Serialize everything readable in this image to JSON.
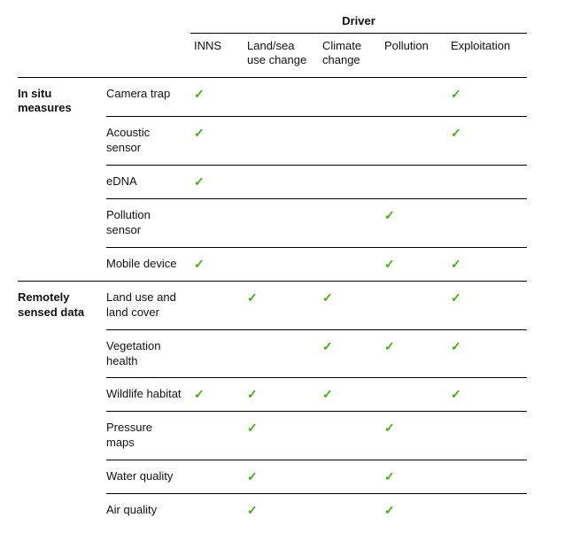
{
  "header": {
    "super": "Driver"
  },
  "columns": [
    "INNS",
    "Land/sea use change",
    "Climate change",
    "Pollution",
    "Exploitation"
  ],
  "groups": [
    {
      "name": "In situ measures",
      "rows": [
        {
          "label": "Camera trap",
          "marks": [
            true,
            false,
            false,
            false,
            true
          ]
        },
        {
          "label": "Acoustic sensor",
          "marks": [
            true,
            false,
            false,
            false,
            true
          ]
        },
        {
          "label": "eDNA",
          "marks": [
            true,
            false,
            false,
            false,
            false
          ]
        },
        {
          "label": "Pollution sensor",
          "marks": [
            false,
            false,
            false,
            true,
            false
          ]
        },
        {
          "label": "Mobile device",
          "marks": [
            true,
            false,
            false,
            true,
            true
          ]
        }
      ]
    },
    {
      "name": "Remotely sensed data",
      "rows": [
        {
          "label": "Land use and land cover",
          "marks": [
            false,
            true,
            true,
            false,
            true
          ]
        },
        {
          "label": "Vegetation health",
          "marks": [
            false,
            false,
            true,
            true,
            true
          ]
        },
        {
          "label": "Wildlife habitat",
          "marks": [
            true,
            true,
            true,
            false,
            true
          ]
        },
        {
          "label": "Pressure maps",
          "marks": [
            false,
            true,
            false,
            true,
            false
          ]
        },
        {
          "label": "Water quality",
          "marks": [
            false,
            true,
            false,
            true,
            false
          ]
        },
        {
          "label": "Air quality",
          "marks": [
            false,
            true,
            false,
            true,
            false
          ]
        }
      ]
    }
  ]
}
